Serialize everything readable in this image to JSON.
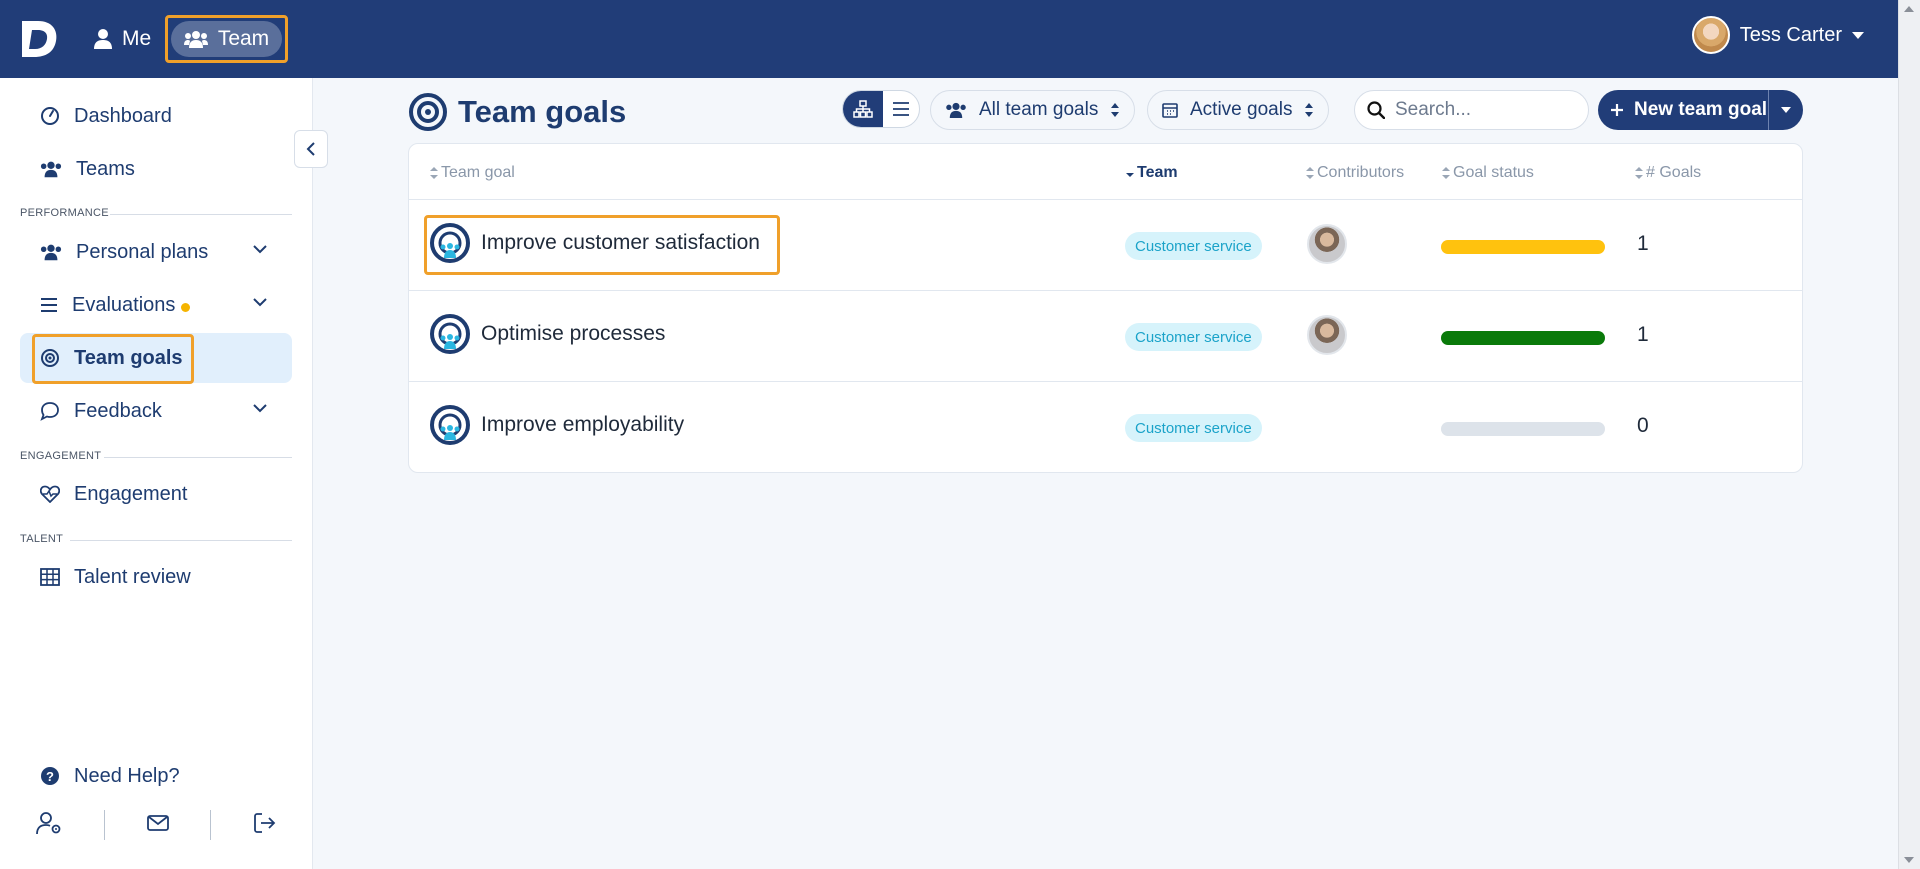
{
  "topbar": {
    "nav_me": "Me",
    "nav_team": "Team",
    "user_name": "Tess Carter"
  },
  "sidebar": {
    "items": [
      {
        "label": "Dashboard",
        "icon": "dashboard-icon"
      },
      {
        "label": "Teams",
        "icon": "users-icon"
      },
      {
        "label": "Personal plans",
        "icon": "users-icon"
      },
      {
        "label": "Evaluations",
        "icon": "list-icon"
      },
      {
        "label": "Team goals",
        "icon": "target-icon"
      },
      {
        "label": "Feedback",
        "icon": "chat-icon"
      },
      {
        "label": "Engagement",
        "icon": "heart-pulse-icon"
      },
      {
        "label": "Talent review",
        "icon": "grid-icon"
      }
    ],
    "sections": {
      "performance": "PERFORMANCE",
      "engagement": "ENGAGEMENT",
      "talent": "TALENT"
    },
    "help": "Need Help?"
  },
  "main": {
    "title": "Team goals",
    "filter_scope": "All team goals",
    "filter_status": "Active goals",
    "search_placeholder": "Search...",
    "new_goal_label": "New team goal",
    "columns": {
      "goal": "Team goal",
      "team": "Team",
      "contributors": "Contributors",
      "status": "Goal status",
      "goals": "# Goals"
    },
    "rows": [
      {
        "goal": "Improve customer satisfaction",
        "team": "Customer service",
        "has_contributor": true,
        "status_color": "#ffc20e",
        "goals": "1"
      },
      {
        "goal": "Optimise processes",
        "team": "Customer service",
        "has_contributor": true,
        "status_color": "#0a7a0a",
        "goals": "1"
      },
      {
        "goal": "Improve employability",
        "team": "Customer service",
        "has_contributor": false,
        "status_color": "#dde3ea",
        "goals": "0"
      }
    ]
  },
  "colors": {
    "navy": "#213d78",
    "highlight": "#f0a02a",
    "badge_bg": "#d6f3fb",
    "badge_text": "#1ba3c9"
  }
}
